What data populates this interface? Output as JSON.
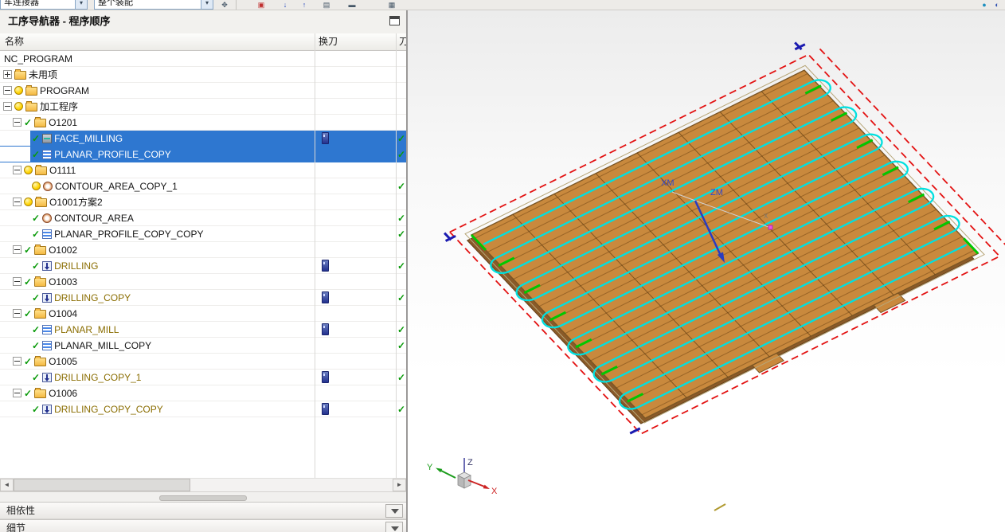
{
  "toolbar": {
    "part_filter": "车连接器",
    "scope_filter": "整个装配",
    "icons": [
      "hand-icon",
      "snapshot-icon",
      "move-down-icon",
      "move-up-icon",
      "measure-icon",
      "keyboard-icon",
      "sphere-icon",
      "globe-icon"
    ]
  },
  "navigator": {
    "title": "工序导航器 - 程序顺序",
    "columns": {
      "name": "名称",
      "tool_change": "换刀",
      "toolpath": "刀"
    },
    "rows": [
      {
        "label": "NC_PROGRAM",
        "level": 0,
        "type": "root",
        "status": "none",
        "selected": false,
        "tool_change": false,
        "toolpath_ok": false
      },
      {
        "label": "未用项",
        "level": 1,
        "type": "folder",
        "expander": "collapsed",
        "status": "none",
        "selected": false,
        "tool_change": false,
        "toolpath_ok": false
      },
      {
        "label": "PROGRAM",
        "level": 1,
        "type": "folder",
        "expander": "expanded",
        "status": "bulb",
        "selected": false,
        "tool_change": false,
        "toolpath_ok": false
      },
      {
        "label": "加工程序",
        "level": 1,
        "type": "folder",
        "expander": "expanded",
        "status": "bulb",
        "selected": false,
        "tool_change": false,
        "toolpath_ok": false
      },
      {
        "label": "O1201",
        "level": 2,
        "type": "folder",
        "expander": "expanded",
        "status": "check",
        "selected": false,
        "tool_change": false,
        "toolpath_ok": false
      },
      {
        "label": "FACE_MILLING",
        "level": 3,
        "type": "operation-mill",
        "status": "check",
        "selected": true,
        "tool_change": true,
        "toolpath_ok": true
      },
      {
        "label": "PLANAR_PROFILE_COPY",
        "level": 3,
        "type": "operation-planar",
        "status": "check",
        "selected": true,
        "tool_change": false,
        "toolpath_ok": true
      },
      {
        "label": "O1111",
        "level": 2,
        "type": "folder",
        "expander": "expanded",
        "status": "bulb",
        "selected": false,
        "tool_change": false,
        "toolpath_ok": false
      },
      {
        "label": "CONTOUR_AREA_COPY_1",
        "level": 3,
        "type": "operation-contour",
        "status": "bulb",
        "selected": false,
        "tool_change": false,
        "toolpath_ok": true
      },
      {
        "label": "O1001方案2",
        "level": 2,
        "type": "folder",
        "expander": "expanded",
        "status": "bulb",
        "selected": false,
        "tool_change": false,
        "toolpath_ok": false
      },
      {
        "label": "CONTOUR_AREA",
        "level": 3,
        "type": "operation-contour",
        "status": "check",
        "selected": false,
        "tool_change": false,
        "toolpath_ok": true
      },
      {
        "label": "PLANAR_PROFILE_COPY_COPY",
        "level": 3,
        "type": "operation-planar",
        "status": "check",
        "selected": false,
        "tool_change": false,
        "toolpath_ok": true
      },
      {
        "label": "O1002",
        "level": 2,
        "type": "folder",
        "expander": "expanded",
        "status": "check",
        "selected": false,
        "tool_change": false,
        "toolpath_ok": false
      },
      {
        "label": "DRILLING",
        "level": 3,
        "type": "operation-drill",
        "status": "check",
        "label_color": "brown",
        "selected": false,
        "tool_change": true,
        "toolpath_ok": true
      },
      {
        "label": "O1003",
        "level": 2,
        "type": "folder",
        "expander": "expanded",
        "status": "check",
        "selected": false,
        "tool_change": false,
        "toolpath_ok": false
      },
      {
        "label": "DRILLING_COPY",
        "level": 3,
        "type": "operation-drill",
        "status": "check",
        "label_color": "brown",
        "selected": false,
        "tool_change": true,
        "toolpath_ok": true
      },
      {
        "label": "O1004",
        "level": 2,
        "type": "folder",
        "expander": "expanded",
        "status": "check",
        "selected": false,
        "tool_change": false,
        "toolpath_ok": false
      },
      {
        "label": "PLANAR_MILL",
        "level": 3,
        "type": "operation-planar",
        "status": "check",
        "label_color": "brown",
        "selected": false,
        "tool_change": true,
        "toolpath_ok": true
      },
      {
        "label": "PLANAR_MILL_COPY",
        "level": 3,
        "type": "operation-planar",
        "status": "check",
        "selected": false,
        "tool_change": false,
        "toolpath_ok": true
      },
      {
        "label": "O1005",
        "level": 2,
        "type": "folder",
        "expander": "expanded",
        "status": "check",
        "selected": false,
        "tool_change": false,
        "toolpath_ok": false
      },
      {
        "label": "DRILLING_COPY_1",
        "level": 3,
        "type": "operation-drill",
        "status": "check",
        "label_color": "brown",
        "selected": false,
        "tool_change": true,
        "toolpath_ok": true
      },
      {
        "label": "O1006",
        "level": 2,
        "type": "folder",
        "expander": "expanded",
        "status": "check",
        "selected": false,
        "tool_change": false,
        "toolpath_ok": false
      },
      {
        "label": "DRILLING_COPY_COPY",
        "level": 3,
        "type": "operation-drill",
        "status": "check",
        "label_color": "brown",
        "selected": false,
        "tool_change": true,
        "toolpath_ok": true
      }
    ],
    "sections": {
      "dependencies": "相依性",
      "details": "细节"
    }
  },
  "viewport": {
    "axis_xm": "XM",
    "axis_zm": "ZM",
    "axis_x_small": "X",
    "triad_x": "X",
    "triad_y": "Y",
    "triad_z": "Z",
    "colors": {
      "plate": "#c9893d",
      "toolpath": "#00e0e0",
      "boundary": "#e31212",
      "engage": "#00c800",
      "corner_marks": "#1b1bb0",
      "selection": "#2e77d0"
    }
  }
}
